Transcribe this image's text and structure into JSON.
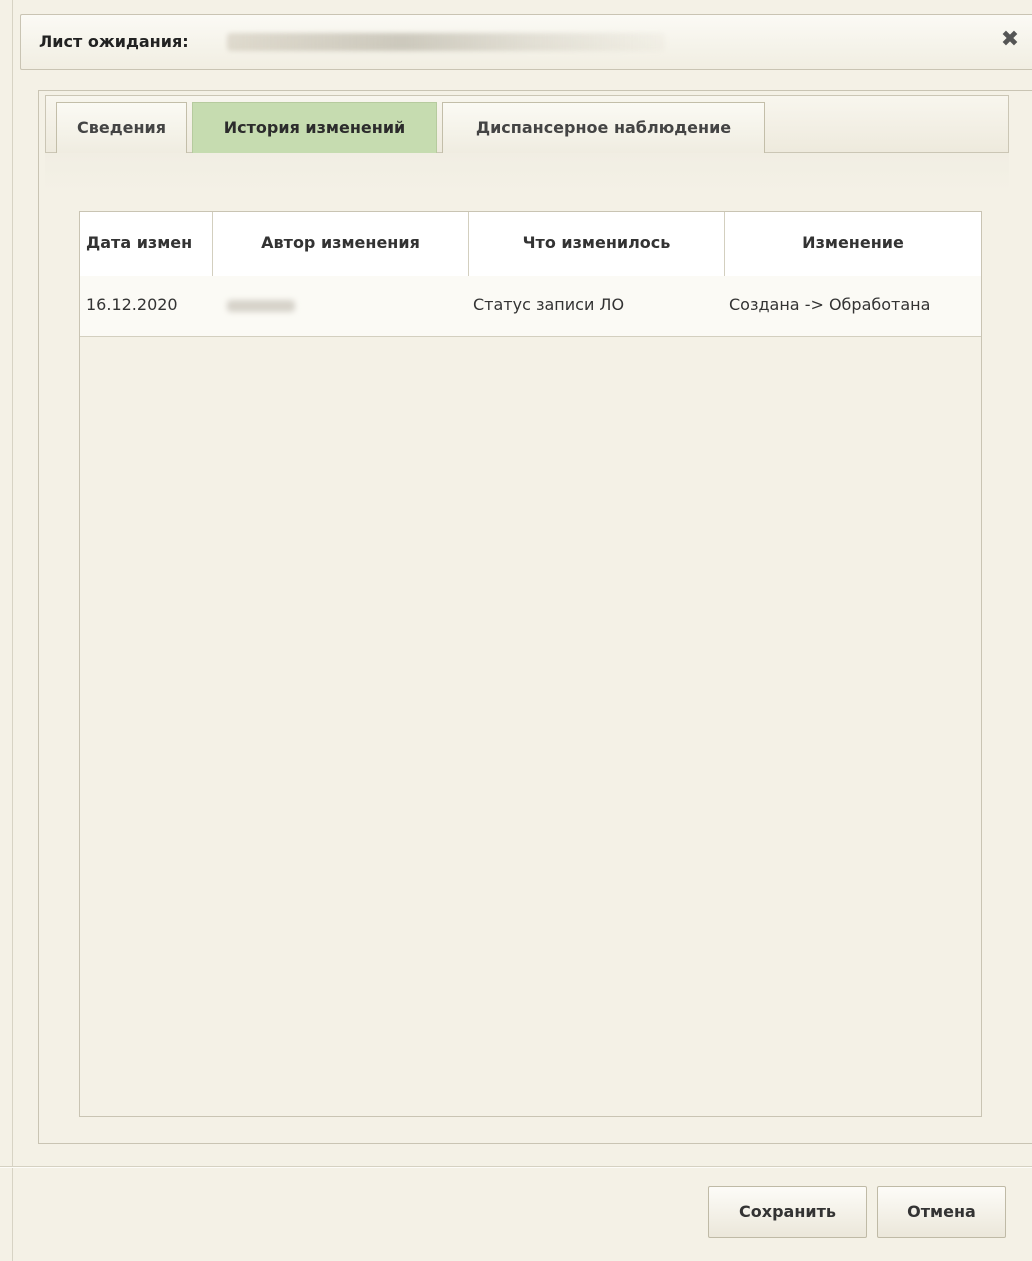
{
  "dialog": {
    "title_label": "Лист ожидания:",
    "close_icon": "close-icon"
  },
  "tabs": [
    {
      "label": "Сведения",
      "active": false
    },
    {
      "label": "История изменений",
      "active": true
    },
    {
      "label": "Диспансерное наблюдение",
      "active": false
    }
  ],
  "grid": {
    "columns": [
      "Дата измен",
      "Автор изменения",
      "Что изменилось",
      "Изменение"
    ],
    "rows": [
      {
        "date": "16.12.2020",
        "author": "",
        "what": "Статус записи ЛО",
        "change": "Создана -> Обработана"
      }
    ]
  },
  "footer": {
    "save_label": "Сохранить",
    "cancel_label": "Отмена"
  },
  "colors": {
    "active_tab": "#c6dcb0",
    "background": "#f4f1e6"
  }
}
